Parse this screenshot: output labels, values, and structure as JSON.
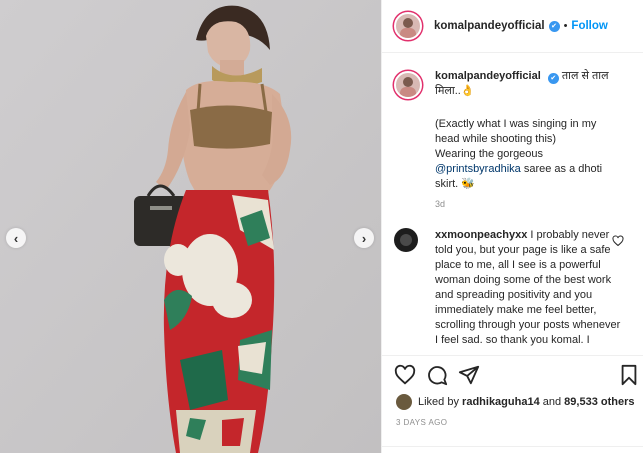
{
  "post": {
    "username": "komalpandeyofficial",
    "follow_label": "Follow",
    "separator": "•"
  },
  "caption": {
    "username": "komalpandeyofficial",
    "text_intro": "ताल से ताल मिला..👌",
    "text_line1": "(Exactly what I was singing in my head while shooting this)",
    "text_line2_pre": "Wearing the gorgeous",
    "mention": "@printsbyradhika",
    "text_line2_post": "saree as a dhoti skirt. 🐝",
    "time": "3d"
  },
  "comment": {
    "username": "xxmoonpeachyxx",
    "text": "I probably never told you, but your page is like a safe place to me, all I see is a powerful woman doing some of the best work and spreading positivity and you immediately make me feel better, scrolling through your posts whenever I feel sad. so thank you komal. I"
  },
  "likes": {
    "prefix": "Liked by",
    "user": "radhikaguha14",
    "middle": "and",
    "others": "89,533 others"
  },
  "time_ago": "3 DAYS AGO",
  "colors": {
    "link": "#0095f6",
    "mention": "#00376b",
    "verified": "#3897f0",
    "muted": "#8e8e8e"
  },
  "icons": {
    "prev": "chevron-left-icon",
    "next": "chevron-right-icon",
    "like": "heart-icon",
    "comment": "comment-icon",
    "share": "send-icon",
    "save": "bookmark-icon"
  }
}
